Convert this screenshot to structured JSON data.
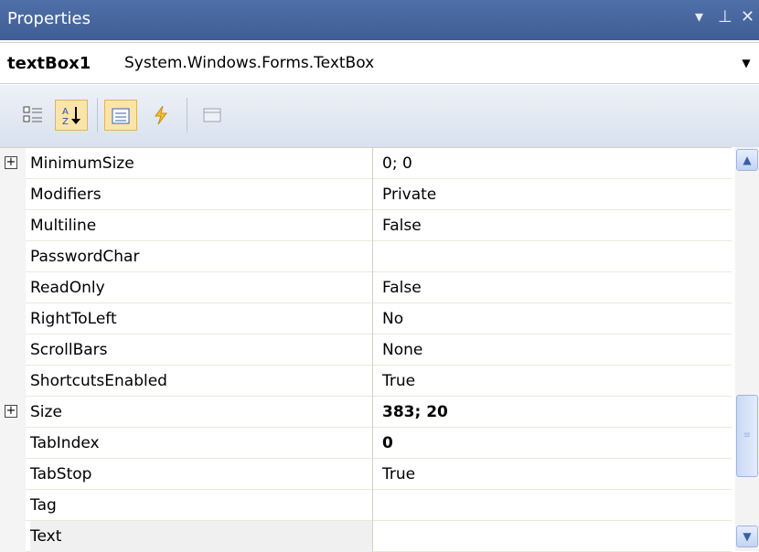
{
  "window": {
    "title": "Properties",
    "dropdown_icon": "dropdown-arrow-icon",
    "pin_icon": "pin-icon",
    "close_icon": "close-icon"
  },
  "object_selector": {
    "name": "textBox1",
    "type": "System.Windows.Forms.TextBox"
  },
  "toolbar": {
    "buttons": [
      {
        "name": "categorized",
        "icon": "categorized-icon",
        "active": false
      },
      {
        "name": "alphabetical",
        "icon": "sort-az-icon",
        "active": true
      },
      {
        "name": "properties",
        "icon": "properties-icon",
        "active": true
      },
      {
        "name": "events",
        "icon": "events-lightning-icon",
        "active": false
      },
      {
        "name": "property-pages",
        "icon": "property-pages-icon",
        "active": false
      }
    ]
  },
  "properties": [
    {
      "name": "MinimumSize",
      "value": "0; 0",
      "expandable": true,
      "bold": false
    },
    {
      "name": "Modifiers",
      "value": "Private",
      "expandable": false,
      "bold": false
    },
    {
      "name": "Multiline",
      "value": "False",
      "expandable": false,
      "bold": false
    },
    {
      "name": "PasswordChar",
      "value": "",
      "expandable": false,
      "bold": false
    },
    {
      "name": "ReadOnly",
      "value": "False",
      "expandable": false,
      "bold": false
    },
    {
      "name": "RightToLeft",
      "value": "No",
      "expandable": false,
      "bold": false
    },
    {
      "name": "ScrollBars",
      "value": "None",
      "expandable": false,
      "bold": false
    },
    {
      "name": "ShortcutsEnabled",
      "value": "True",
      "expandable": false,
      "bold": false
    },
    {
      "name": "Size",
      "value": "383; 20",
      "expandable": true,
      "bold": true
    },
    {
      "name": "TabIndex",
      "value": "0",
      "expandable": false,
      "bold": true
    },
    {
      "name": "TabStop",
      "value": "True",
      "expandable": false,
      "bold": false
    },
    {
      "name": "Tag",
      "value": "",
      "expandable": false,
      "bold": false
    },
    {
      "name": "Text",
      "value": "",
      "expandable": false,
      "bold": false,
      "selected": true
    }
  ]
}
